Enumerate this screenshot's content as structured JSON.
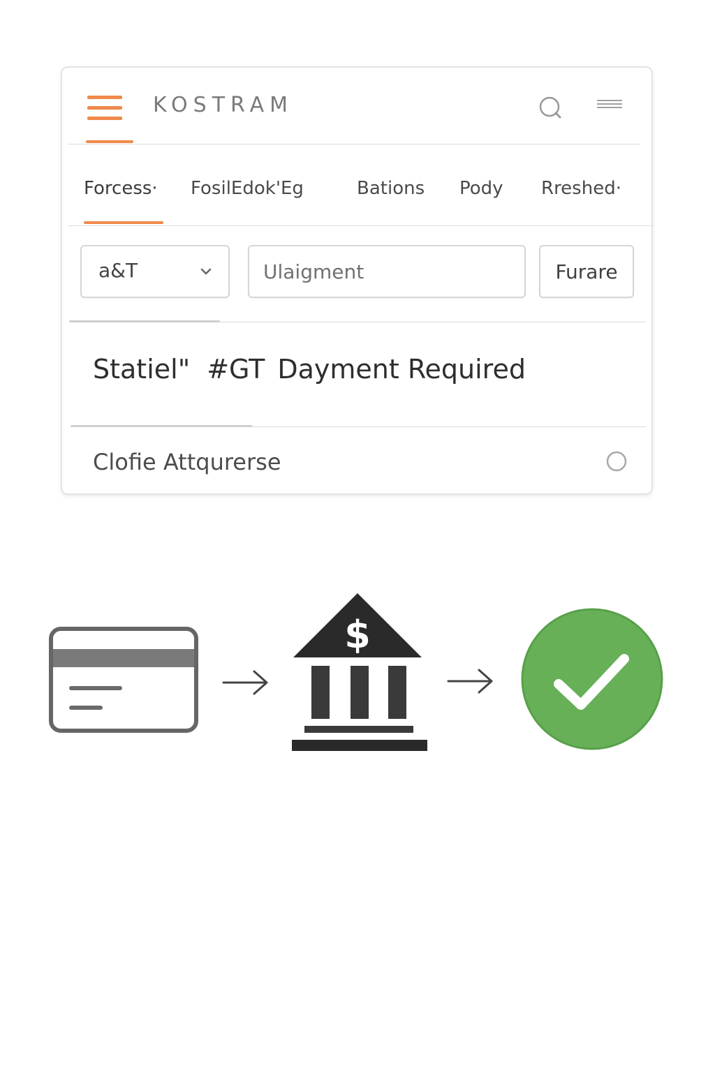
{
  "header": {
    "brand": "KOSTRAM",
    "search_icon": "search-icon",
    "menu_icon": "menu-icon",
    "hamburger_icon": "hamburger-icon"
  },
  "tabs": [
    {
      "label": "Forcess·",
      "active": true
    },
    {
      "label": "FosilEdok'Eg",
      "active": false
    },
    {
      "label": "Bations",
      "active": false
    },
    {
      "label": "Pody",
      "active": false
    },
    {
      "label": "Rreshed·",
      "active": false
    }
  ],
  "filters": {
    "select_value": "a&T",
    "input_placeholder": "Ulaigment",
    "button_label": "Furare"
  },
  "status": {
    "label": "Statiel\"",
    "code": "#GT",
    "message": "Dayment Required"
  },
  "footer": {
    "text": "Clofie Attqurerse"
  },
  "flow": {
    "steps": [
      "credit-card-icon",
      "bank-icon",
      "checkmark-circle-icon"
    ],
    "arrows": [
      "arrow-right-icon",
      "arrow-right-icon"
    ]
  },
  "colors": {
    "accent": "#f08a4b",
    "success": "#67b058",
    "bank": "#2a2a2a",
    "card_outline": "#666666"
  }
}
